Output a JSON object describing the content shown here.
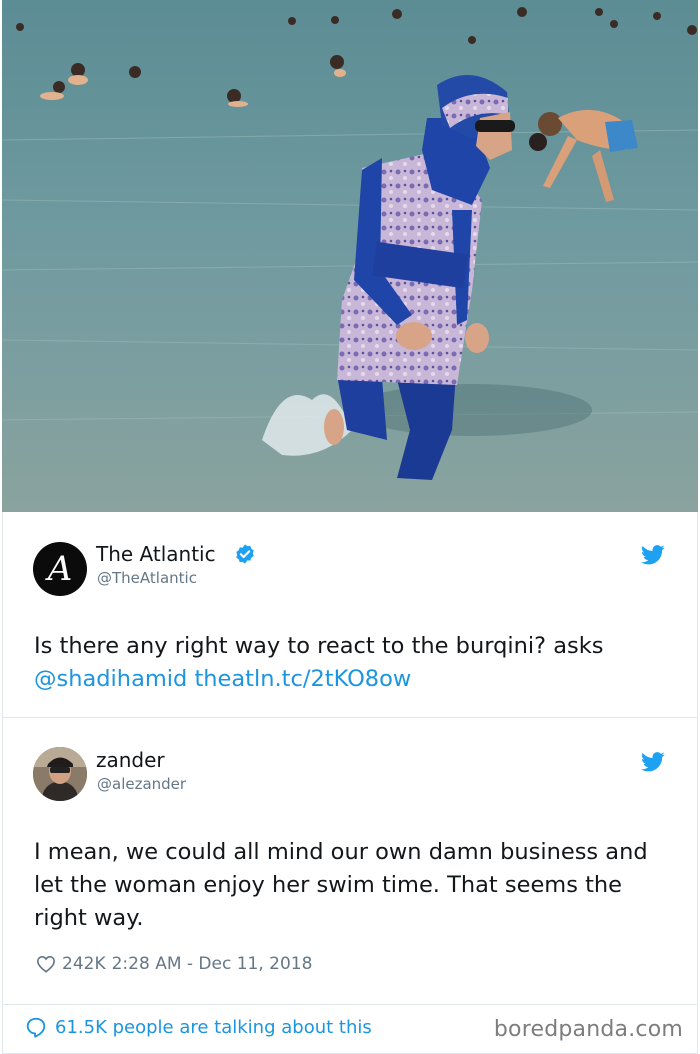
{
  "tweet_quoted": {
    "author_name": "The Atlantic",
    "handle": "@TheAtlantic",
    "avatar_letter": "A",
    "text_prefix": "Is there any right way to react to the burqini? asks ",
    "mention": "@shadihamid",
    "link": "theatln.tc/2tKO8ow"
  },
  "tweet_reply": {
    "author_name": "zander",
    "handle": "@alezander",
    "text": "I mean, we could all mind our own damn business and let the woman enjoy her swim time. That seems the right way.",
    "likes": "242K",
    "timestamp": "2:28 AM - Dec 11, 2018"
  },
  "footer": {
    "talking": "61.5K people are talking about this",
    "brand": "boredpanda.com"
  },
  "icons": {
    "verified": "verified-badge-icon",
    "twitter": "twitter-bird-icon",
    "like": "heart-icon",
    "reply": "speech-bubble-icon"
  },
  "colors": {
    "link": "#1b95e0",
    "secondary": "#657786",
    "text": "#14171a"
  }
}
